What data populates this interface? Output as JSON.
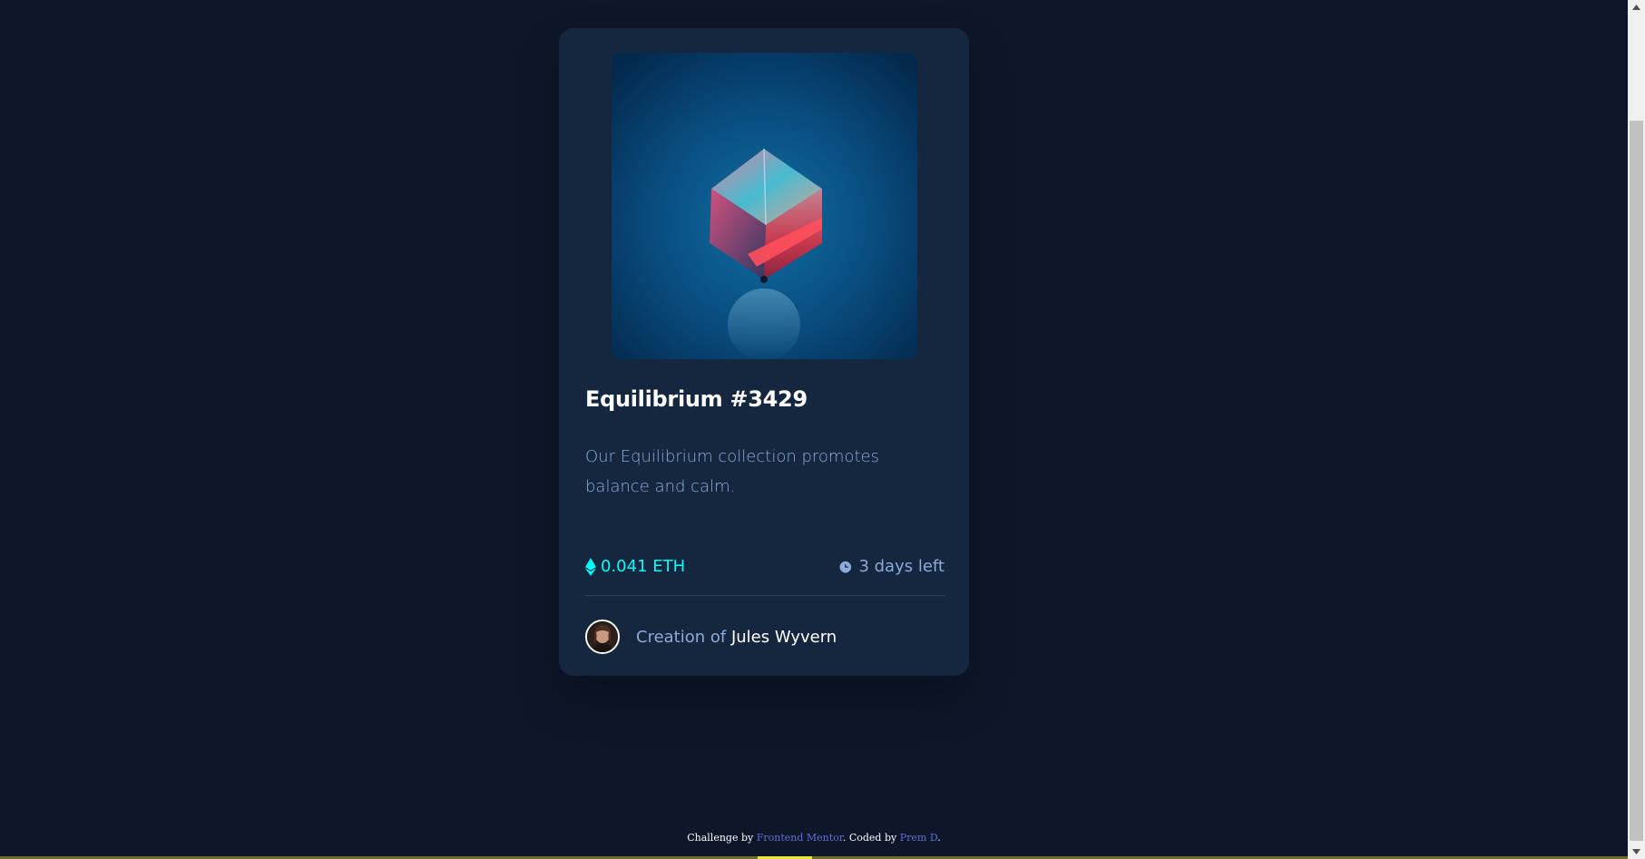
{
  "card": {
    "image_alt": "equilibrium-cube",
    "title": "Equilibrium #3429",
    "description": "Our Equilibrium collection promotes balance and calm.",
    "price": "0.041 ETH",
    "time_left": "3 days left",
    "creator_prefix": "Creation of",
    "creator_name": "Jules Wyvern"
  },
  "attribution": {
    "prefix": "Challenge by",
    "challenge_link": "Frontend Mentor",
    "middle": ". Coded by",
    "author_link": "Prem D",
    "suffix": "."
  },
  "colors": {
    "page_bg": "#0d1729",
    "card_bg": "#15263f",
    "accent_cyan": "#00fff8",
    "text_soft_blue": "#8bacd9",
    "link_blue": "#5e6fd8"
  },
  "icons": {
    "price": "ethereum-icon",
    "time": "clock-icon",
    "scroll_up": "chevron-up-icon",
    "scroll_down": "chevron-down-icon"
  }
}
